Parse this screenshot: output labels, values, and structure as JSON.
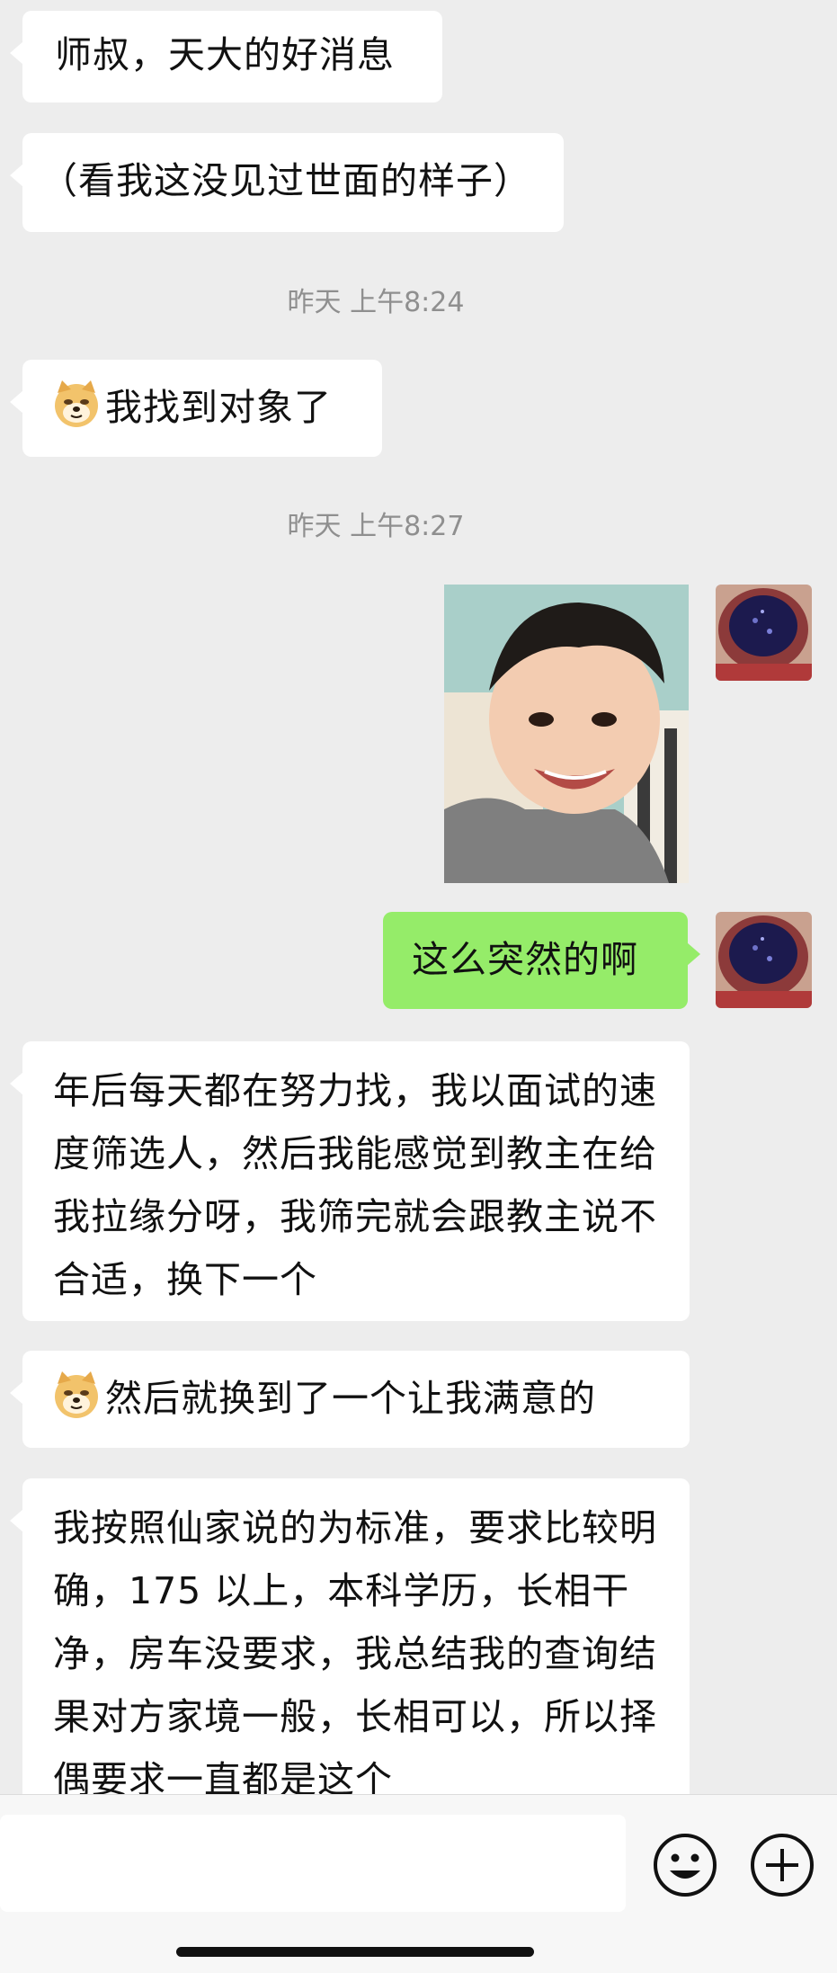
{
  "messages": {
    "m1": "师叔，天大的好消息",
    "m2": "（看我这没见过世面的样子）",
    "ts1": "昨天 上午8:24",
    "m3": "我找到对象了",
    "ts2": "昨天 上午8:27",
    "m4": "这么突然的啊",
    "m5": "年后每天都在努力找，我以面试的速度筛选人，然后我能感觉到教主在给我拉缘分呀，我筛完就会跟教主说不合适，换下一个",
    "m6": "然后就换到了一个让我满意的",
    "m7": "我按照仙家说的为标准，要求比较明确，175 以上，本科学历，长相干净，房车没要求，我总结我的查询结果对方家境一般，长相可以，所以择偶要求一直都是这个"
  },
  "icons": {
    "sticker": "doge-emoji",
    "emoji_button": "smiley-icon",
    "more_button": "plus-icon"
  },
  "colors": {
    "background": "#ededed",
    "incoming_bubble": "#ffffff",
    "outgoing_bubble": "#95ec69",
    "timestamp": "#8f8f8f"
  }
}
